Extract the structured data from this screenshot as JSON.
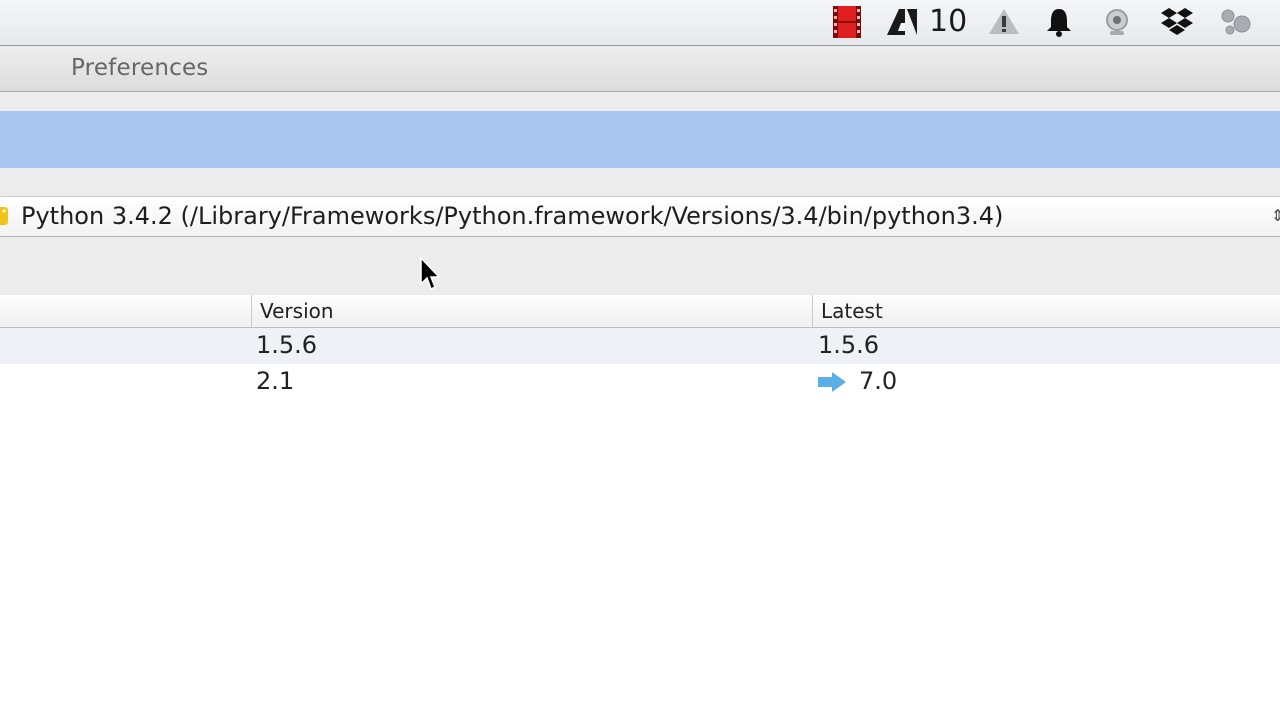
{
  "menubar": {
    "icons": [
      "film-strip-icon",
      "adobe-icon",
      "warning-drive-icon",
      "bell-icon",
      "webcam-icon",
      "dropbox-icon",
      "molecule-icon"
    ],
    "adobe_badge": "10"
  },
  "toolbar": {
    "preferences_label": "Preferences"
  },
  "interpreter": {
    "label": "Python 3.4.2 (/Library/Frameworks/Python.framework/Versions/3.4/bin/python3.4)"
  },
  "packages_table": {
    "columns": {
      "version": "Version",
      "latest": "Latest"
    },
    "rows": [
      {
        "version": "1.5.6",
        "latest": "1.5.6",
        "update_available": false
      },
      {
        "version": "2.1",
        "latest": "7.0",
        "update_available": true
      }
    ]
  },
  "colors": {
    "selection_band": "#a9c6f0",
    "update_arrow": "#5ab0e6",
    "film_icon": "#e02020"
  }
}
